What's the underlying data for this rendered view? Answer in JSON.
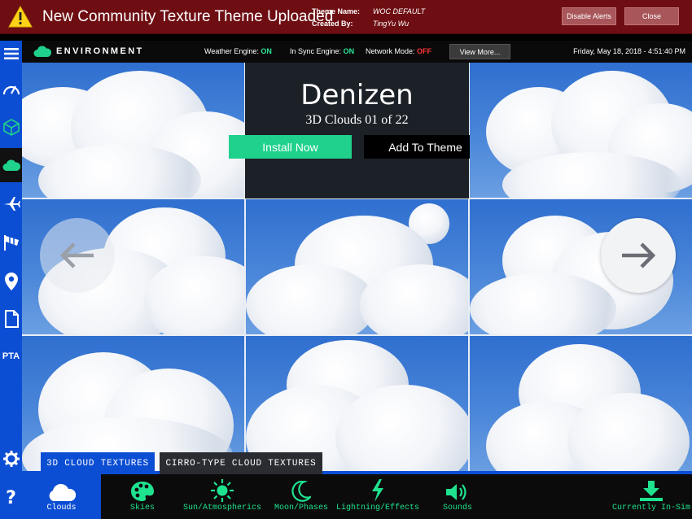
{
  "alert": {
    "title": "New Community Texture Theme Uploaded",
    "theme_name_label": "Theme Name:",
    "theme_name_value": "WOC DEFAULT",
    "created_by_label": "Created By:",
    "created_by_value": "TingYu Wu",
    "disable_alerts_label": "Disable Alerts",
    "close_label": "Close",
    "icon": "warning-icon"
  },
  "status": {
    "brand": "ENVIRONMENT",
    "weather_label": "Weather Engine:",
    "weather_value": "ON",
    "sync_label": "In Sync Engine:",
    "sync_value": "ON",
    "network_label": "Network Mode:",
    "network_value": "OFF",
    "view_more_label": "View More...",
    "datetime": "Friday, May 18, 2018 - 4:51:40 PM"
  },
  "rail": {
    "items": [
      {
        "icon": "menu-icon"
      },
      {
        "icon": "gauge-icon"
      },
      {
        "icon": "cube-icon"
      },
      {
        "icon": "cloud-icon",
        "active": true
      },
      {
        "icon": "airplane-icon"
      },
      {
        "icon": "windsock-icon"
      },
      {
        "icon": "location-pin-icon"
      },
      {
        "icon": "document-icon"
      },
      {
        "icon": "pta-icon",
        "label": "PTA"
      },
      {
        "icon": "gear-icon"
      },
      {
        "icon": "help-icon",
        "label": "?"
      }
    ]
  },
  "feature": {
    "name": "Denizen",
    "subtitle": "3D Clouds 01 of 22",
    "install_label": "Install Now",
    "add_theme_label": "Add To Theme"
  },
  "texture_tabs": [
    {
      "label": "3D CLOUD TEXTURES",
      "active": true
    },
    {
      "label": "CIRRO-TYPE CLOUD TEXTURES",
      "active": false
    }
  ],
  "bottom_nav": [
    {
      "label": "Clouds",
      "icon": "cloud-icon",
      "active": true
    },
    {
      "label": "Skies",
      "icon": "palette-icon"
    },
    {
      "label": "Sun/Atmospherics",
      "icon": "sun-icon"
    },
    {
      "label": "Moon/Phases",
      "icon": "moon-icon"
    },
    {
      "label": "Lightning/Effects",
      "icon": "lightning-icon"
    },
    {
      "label": "Sounds",
      "icon": "speaker-icon"
    },
    {
      "label": "Currently In-Sim",
      "icon": "download-icon"
    }
  ],
  "colors": {
    "alert_bg": "#6e0e12",
    "rail_blue": "#0c4ed3",
    "accent_green": "#1fd18b",
    "status_on": "#2fe39a",
    "status_off": "#ff3535"
  }
}
